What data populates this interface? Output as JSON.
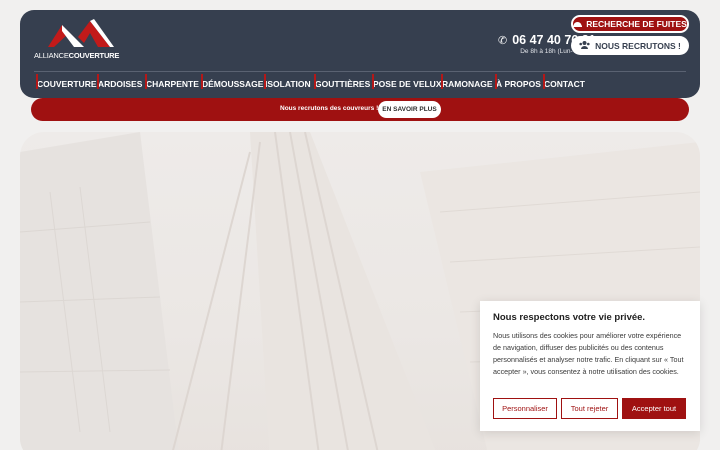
{
  "header": {
    "logo": {
      "text_light": "ALLIANCE",
      "text_bold": "COUVERTURE"
    },
    "phone": {
      "icon": "phone-icon",
      "number": "06 47 40 76 81",
      "hours": "De 8h à 18h (Lun-Ven)"
    },
    "leak_button": {
      "icon": "helmet-icon",
      "label": "RECHERCHE DE FUITES"
    },
    "recruit_button": {
      "icon": "users-icon",
      "label": "NOUS RECRUTONS !"
    },
    "nav": [
      "COUVERTURE",
      "ARDOISES",
      "CHARPENTE",
      "DÉMOUSSAGE",
      "ISOLATION",
      "GOUTTIÈRES",
      "POSE DE VELUX",
      "RAMONAGE",
      "À PROPOS",
      "CONTACT"
    ]
  },
  "announcement": {
    "text": "Nous recrutons des couvreurs !",
    "button": "EN SAVOIR PLUS"
  },
  "cookie": {
    "title": "Nous respectons votre vie privée.",
    "text": "Nous utilisons des cookies pour améliorer votre expérience de navigation, diffuser des publicités ou des contenus personnalisés et analyser notre trafic. En cliquant sur « Tout accepter », vous consentez à notre utilisation des cookies.",
    "buttons": {
      "customize": "Personnaliser",
      "reject": "Tout rejeter",
      "accept": "Accepter tout"
    }
  },
  "colors": {
    "header_bg": "#363f4f",
    "brand_red": "#9f1111",
    "page_bg": "#f1f0ef"
  }
}
